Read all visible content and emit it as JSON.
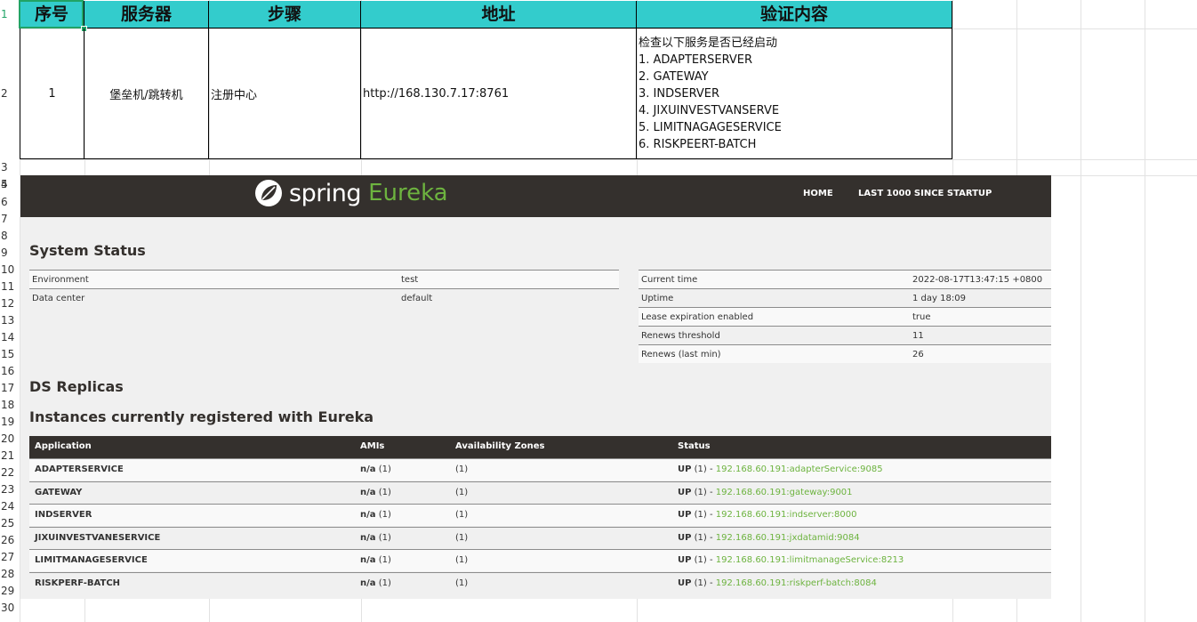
{
  "row_numbers": [
    "1",
    "2",
    "3",
    "4",
    "5",
    "6",
    "7",
    "8",
    "9",
    "10",
    "11",
    "12",
    "13",
    "14",
    "15",
    "16",
    "17",
    "18",
    "19",
    "20",
    "21",
    "22",
    "23",
    "24",
    "25",
    "26",
    "27",
    "28",
    "29",
    "30"
  ],
  "sheet": {
    "headers": {
      "seq": "序号",
      "server": "服务器",
      "step": "步骤",
      "address": "地址",
      "verify": "验证内容"
    },
    "row": {
      "seq": "1",
      "server": "堡垒机/跳转机",
      "step": "注册中心",
      "address": "http://168.130.7.17:8761",
      "verify_lines": [
        "检查以下服务是否已经启动",
        "1. ADAPTERSERVER",
        "2. GATEWAY",
        "3. INDSERVER",
        "4. JIXUINVESTVANSERVE",
        "5. LIMITNAGAGESERVICE",
        "6. RISKPEERT-BATCH"
      ]
    }
  },
  "eureka": {
    "logo_word": "spring",
    "logo_product": "Eureka",
    "nav": {
      "home": "HOME",
      "last1000": "LAST 1000 SINCE STARTUP"
    },
    "system_status_title": "System Status",
    "env_table": [
      {
        "label": "Environment",
        "value": "test"
      },
      {
        "label": "Data center",
        "value": "default"
      }
    ],
    "status_table": [
      {
        "label": "Current time",
        "value": "2022-08-17T13:47:15 +0800"
      },
      {
        "label": "Uptime",
        "value": "1 day 18:09"
      },
      {
        "label": "Lease expiration enabled",
        "value": "true"
      },
      {
        "label": "Renews threshold",
        "value": "11"
      },
      {
        "label": "Renews (last min)",
        "value": "26"
      }
    ],
    "ds_replicas_title": "DS Replicas",
    "instances_title": "Instances currently registered with Eureka",
    "instances_headers": {
      "application": "Application",
      "amis": "AMIs",
      "zones": "Availability Zones",
      "status": "Status"
    },
    "instances": [
      {
        "app": "ADAPTERSERVICE",
        "ami_label": "n/a",
        "ami_count": "(1)",
        "zones": "(1)",
        "status": "UP",
        "status_count": "(1) -",
        "link": "192.168.60.191:adapterService:9085"
      },
      {
        "app": "GATEWAY",
        "ami_label": "n/a",
        "ami_count": "(1)",
        "zones": "(1)",
        "status": "UP",
        "status_count": "(1) -",
        "link": "192.168.60.191:gateway:9001"
      },
      {
        "app": "INDSERVER",
        "ami_label": "n/a",
        "ami_count": "(1)",
        "zones": "(1)",
        "status": "UP",
        "status_count": "(1) -",
        "link": "192.168.60.191:indserver:8000"
      },
      {
        "app": "JIXUINVESTVANESERVICE",
        "ami_label": "n/a",
        "ami_count": "(1)",
        "zones": "(1)",
        "status": "UP",
        "status_count": "(1) -",
        "link": "192.168.60.191:jxdatamid:9084"
      },
      {
        "app": "LIMITMANAGESERVICE",
        "ami_label": "n/a",
        "ami_count": "(1)",
        "zones": "(1)",
        "status": "UP",
        "status_count": "(1) -",
        "link": "192.168.60.191:limitmanageService:8213"
      },
      {
        "app": "RISKPERF-BATCH",
        "ami_label": "n/a",
        "ami_count": "(1)",
        "zones": "(1)",
        "status": "UP",
        "status_count": "(1) -",
        "link": "192.168.60.191:riskperf-batch:8084"
      }
    ]
  },
  "colors": {
    "header_fill": "#33cccc",
    "eureka_dark": "#34302d",
    "spring_green": "#6db33f",
    "selection": "#21a366"
  }
}
